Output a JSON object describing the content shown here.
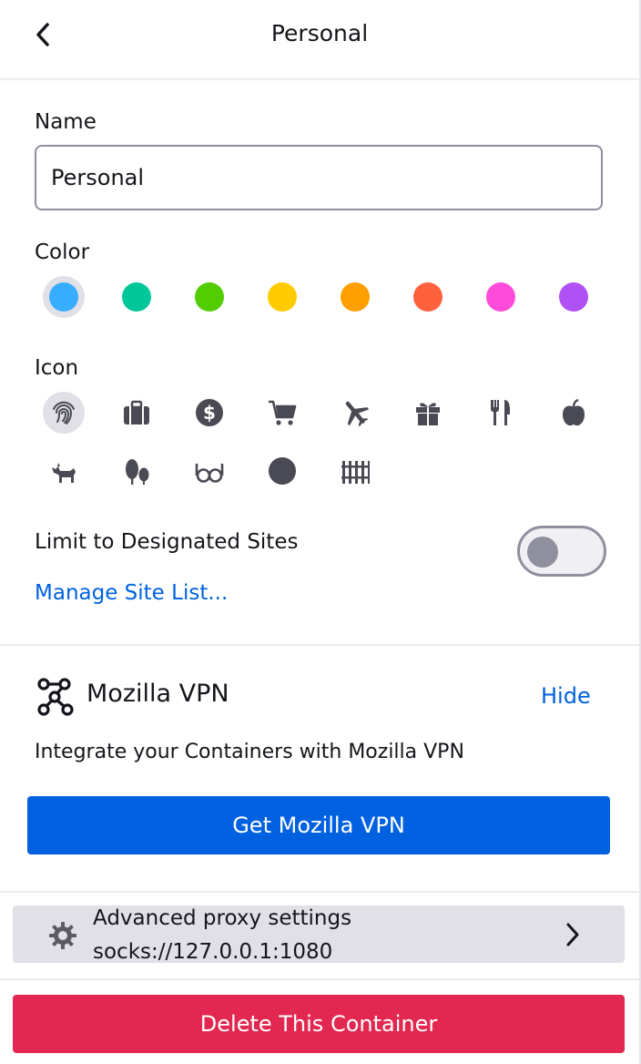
{
  "header": {
    "title": "Personal"
  },
  "form": {
    "name_label": "Name",
    "name_value": "Personal",
    "color_label": "Color",
    "icon_label": "Icon"
  },
  "colors": [
    {
      "name": "blue",
      "hex": "#37adff",
      "selected": true
    },
    {
      "name": "turquoise",
      "hex": "#00c79a",
      "selected": false
    },
    {
      "name": "green",
      "hex": "#51cd00",
      "selected": false
    },
    {
      "name": "yellow",
      "hex": "#ffcb00",
      "selected": false
    },
    {
      "name": "orange",
      "hex": "#ff9f00",
      "selected": false
    },
    {
      "name": "red",
      "hex": "#ff613d",
      "selected": false
    },
    {
      "name": "pink",
      "hex": "#ff4bda",
      "selected": false
    },
    {
      "name": "purple",
      "hex": "#af51f5",
      "selected": false
    }
  ],
  "icons": [
    {
      "name": "fingerprint-icon",
      "selected": true
    },
    {
      "name": "briefcase-icon",
      "selected": false
    },
    {
      "name": "dollar-icon",
      "selected": false
    },
    {
      "name": "cart-icon",
      "selected": false
    },
    {
      "name": "vacation-icon",
      "selected": false
    },
    {
      "name": "gift-icon",
      "selected": false
    },
    {
      "name": "food-icon",
      "selected": false
    },
    {
      "name": "fruit-icon",
      "selected": false
    },
    {
      "name": "pet-icon",
      "selected": false
    },
    {
      "name": "tree-icon",
      "selected": false
    },
    {
      "name": "chill-icon",
      "selected": false
    },
    {
      "name": "circle-icon",
      "selected": false
    },
    {
      "name": "fence-icon",
      "selected": false
    }
  ],
  "limit": {
    "label": "Limit to Designated Sites",
    "enabled": false,
    "manage_link": "Manage Site List..."
  },
  "vpn": {
    "title": "Mozilla VPN",
    "hide_label": "Hide",
    "description": "Integrate your Containers with Mozilla VPN",
    "button_label": "Get Mozilla VPN"
  },
  "proxy": {
    "title": "Advanced proxy settings",
    "value": "socks://127.0.0.1:1080"
  },
  "delete_label": "Delete This Container",
  "accent_color": "#0061e0",
  "danger_color": "#e22850"
}
